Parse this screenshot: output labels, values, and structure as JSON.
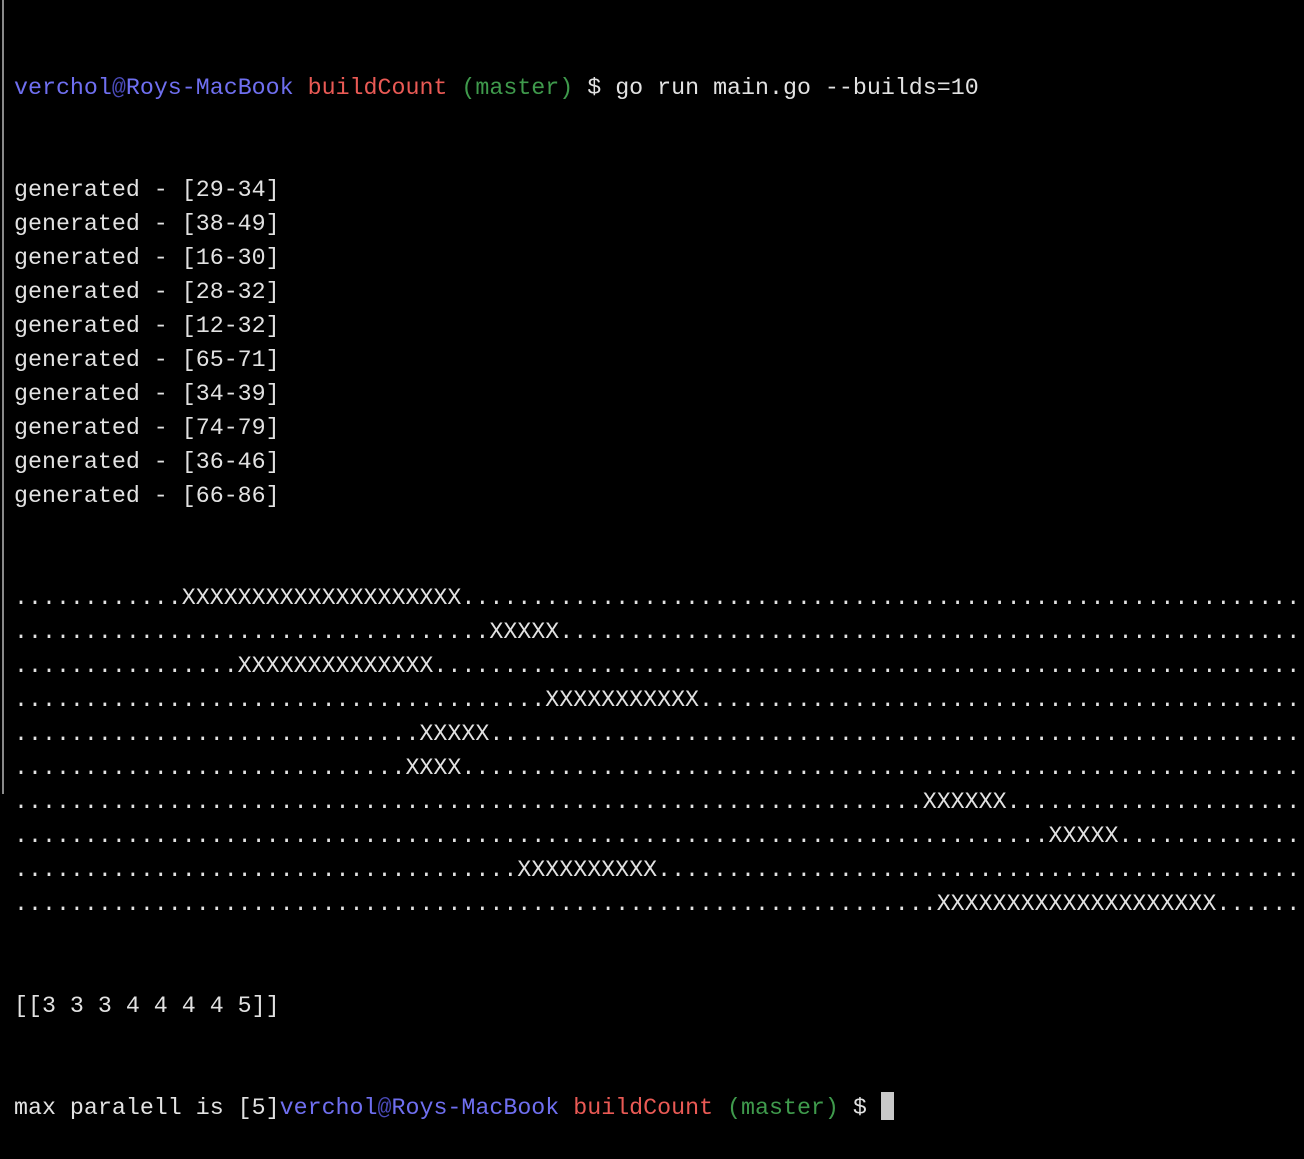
{
  "prompt": {
    "user": "verchol",
    "at": "@",
    "host": "Roys-MacBook",
    "dir": "buildCount",
    "branch": "(master)",
    "symbol": "$"
  },
  "command": "go run main.go --builds=10",
  "generated": [
    "generated - [29-34]",
    "generated - [38-49]",
    "generated - [16-30]",
    "generated - [28-32]",
    "generated - [12-32]",
    "generated - [65-71]",
    "generated - [34-39]",
    "generated - [74-79]",
    "generated - [36-46]",
    "generated - [66-86]"
  ],
  "timeline": [
    "............XXXXXXXXXXXXXXXXXXXX............................................................",
    "..................................XXXXX.....................................................",
    "................XXXXXXXXXXXXXX..............................................................",
    "......................................XXXXXXXXXXX...........................................",
    ".............................XXXXX..........................................................",
    "............................XXXX............................................................",
    ".................................................................XXXXXX.....................",
    "..........................................................................XXXXX.............",
    "....................................XXXXXXXXXX..............................................",
    "..................................................................XXXXXXXXXXXXXXXXXXXX......"
  ],
  "result": "[[3 3 3 4 4 4 4 5]]",
  "max_text": "max paralell is [5]"
}
